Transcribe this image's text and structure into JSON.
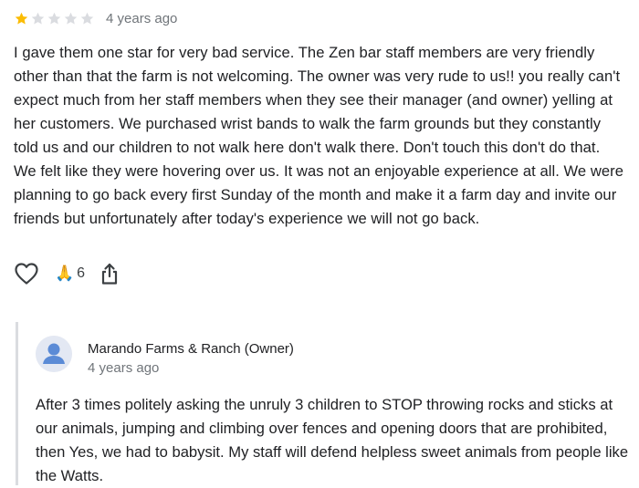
{
  "review": {
    "rating": 1,
    "max_rating": 5,
    "star_filled_color": "#fbbc04",
    "star_empty_color": "#dadce0",
    "time": "4 years ago",
    "text": "I gave them one star for very bad service. The Zen bar staff members are very friendly other than that the farm is not welcoming. The owner was very rude to us!! you really can't expect much from her staff members when they see their manager (and owner) yelling at her customers. We purchased wrist bands to walk the farm grounds but they constantly told us and our children to not walk here don't walk there. Don't touch this don't do that. We felt like they were hovering over us. It was not an enjoyable experience at all. We were planning to go back every first Sunday of the month and make it a farm day and invite our friends but unfortunately after today's experience we will not go back."
  },
  "actions": {
    "like_icon": "heart-outline-icon",
    "reaction_icon": "folded-hands-icon",
    "reaction_glyph": "🙏",
    "reaction_count": "6",
    "share_icon": "share-icon"
  },
  "owner_reply": {
    "name": "Marando Farms & Ranch (Owner)",
    "time": "4 years ago",
    "avatar_icon": "default-avatar-icon",
    "text": "After 3 times politely asking the unruly 3 children to STOP throwing rocks and sticks at our animals, jumping and climbing over fences and opening doors that are prohibited, then Yes, we had to babysit. My staff will defend helpless sweet animals from people like the Watts."
  }
}
